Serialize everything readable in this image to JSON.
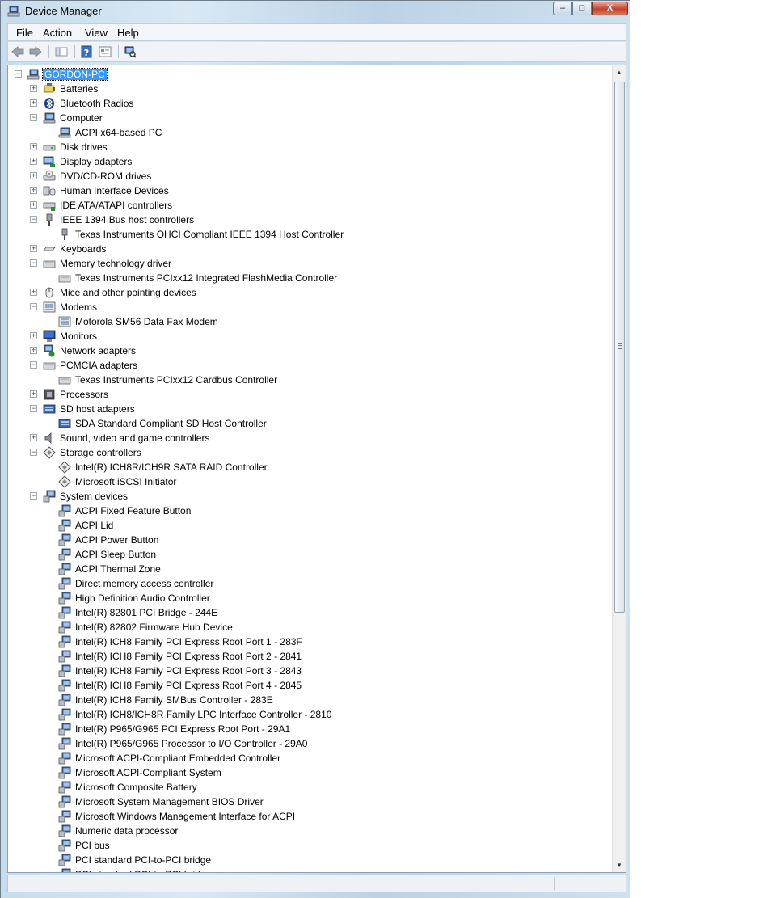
{
  "window": {
    "title": "Device Manager",
    "minimize_glyph": "–",
    "maximize_glyph": "□",
    "close_glyph": "X"
  },
  "menu": [
    "File",
    "Action",
    "View",
    "Help"
  ],
  "toolbar": {
    "icons": [
      "back-arrow-icon",
      "forward-arrow-icon",
      "show-hide-console-tree-icon",
      "help-icon",
      "properties-icon",
      "scan-hardware-icon"
    ]
  },
  "tree": {
    "root": "GORDON-PC",
    "nodes": [
      {
        "label": "Batteries",
        "level": 1,
        "state": "collapsed",
        "icon": "battery-icon"
      },
      {
        "label": "Bluetooth Radios",
        "level": 1,
        "state": "collapsed",
        "icon": "bluetooth-icon"
      },
      {
        "label": "Computer",
        "level": 1,
        "state": "expanded",
        "icon": "computer-icon"
      },
      {
        "label": "ACPI x64-based PC",
        "level": 2,
        "icon": "computer-icon"
      },
      {
        "label": "Disk drives",
        "level": 1,
        "state": "collapsed",
        "icon": "disk-drive-icon"
      },
      {
        "label": "Display adapters",
        "level": 1,
        "state": "collapsed",
        "icon": "display-adapter-icon"
      },
      {
        "label": "DVD/CD-ROM drives",
        "level": 1,
        "state": "collapsed",
        "icon": "dvd-drive-icon"
      },
      {
        "label": "Human Interface Devices",
        "level": 1,
        "state": "collapsed",
        "icon": "hid-icon"
      },
      {
        "label": "IDE ATA/ATAPI controllers",
        "level": 1,
        "state": "collapsed",
        "icon": "ide-controller-icon"
      },
      {
        "label": "IEEE 1394 Bus host controllers",
        "level": 1,
        "state": "expanded",
        "icon": "firewire-icon"
      },
      {
        "label": "Texas Instruments OHCI Compliant IEEE 1394 Host Controller",
        "level": 2,
        "icon": "firewire-icon"
      },
      {
        "label": "Keyboards",
        "level": 1,
        "state": "collapsed",
        "icon": "keyboard-icon"
      },
      {
        "label": "Memory technology driver",
        "level": 1,
        "state": "expanded",
        "icon": "card-icon"
      },
      {
        "label": "Texas Instruments PCIxx12 Integrated FlashMedia Controller",
        "level": 2,
        "icon": "card-icon"
      },
      {
        "label": "Mice and other pointing devices",
        "level": 1,
        "state": "collapsed",
        "icon": "mouse-icon"
      },
      {
        "label": "Modems",
        "level": 1,
        "state": "expanded",
        "icon": "modem-icon"
      },
      {
        "label": "Motorola SM56 Data Fax Modem",
        "level": 2,
        "icon": "modem-icon"
      },
      {
        "label": "Monitors",
        "level": 1,
        "state": "collapsed",
        "icon": "monitor-icon"
      },
      {
        "label": "Network adapters",
        "level": 1,
        "state": "collapsed",
        "icon": "network-adapter-icon"
      },
      {
        "label": "PCMCIA adapters",
        "level": 1,
        "state": "expanded",
        "icon": "card-icon"
      },
      {
        "label": "Texas Instruments PCIxx12 Cardbus Controller",
        "level": 2,
        "icon": "card-icon"
      },
      {
        "label": "Processors",
        "level": 1,
        "state": "collapsed",
        "icon": "processor-icon"
      },
      {
        "label": "SD host adapters",
        "level": 1,
        "state": "expanded",
        "icon": "sd-card-icon"
      },
      {
        "label": "SDA Standard Compliant SD Host Controller",
        "level": 2,
        "icon": "sd-card-icon"
      },
      {
        "label": "Sound, video and game controllers",
        "level": 1,
        "state": "collapsed",
        "icon": "speaker-icon"
      },
      {
        "label": "Storage controllers",
        "level": 1,
        "state": "expanded",
        "icon": "storage-controller-icon"
      },
      {
        "label": "Intel(R) ICH8R/ICH9R SATA RAID Controller",
        "level": 2,
        "icon": "storage-controller-icon"
      },
      {
        "label": "Microsoft iSCSI Initiator",
        "level": 2,
        "icon": "storage-controller-icon"
      },
      {
        "label": "System devices",
        "level": 1,
        "state": "expanded",
        "icon": "system-device-icon"
      },
      {
        "label": "ACPI Fixed Feature Button",
        "level": 2,
        "icon": "system-device-icon"
      },
      {
        "label": "ACPI Lid",
        "level": 2,
        "icon": "system-device-icon"
      },
      {
        "label": "ACPI Power Button",
        "level": 2,
        "icon": "system-device-icon"
      },
      {
        "label": "ACPI Sleep Button",
        "level": 2,
        "icon": "system-device-icon"
      },
      {
        "label": "ACPI Thermal Zone",
        "level": 2,
        "icon": "system-device-icon"
      },
      {
        "label": "Direct memory access controller",
        "level": 2,
        "icon": "system-device-icon"
      },
      {
        "label": "High Definition Audio Controller",
        "level": 2,
        "icon": "system-device-icon"
      },
      {
        "label": "Intel(R) 82801 PCI Bridge - 244E",
        "level": 2,
        "icon": "system-device-icon"
      },
      {
        "label": "Intel(R) 82802 Firmware Hub Device",
        "level": 2,
        "icon": "system-device-icon"
      },
      {
        "label": "Intel(R) ICH8 Family PCI Express Root Port 1 - 283F",
        "level": 2,
        "icon": "system-device-icon"
      },
      {
        "label": "Intel(R) ICH8 Family PCI Express Root Port 2 - 2841",
        "level": 2,
        "icon": "system-device-icon"
      },
      {
        "label": "Intel(R) ICH8 Family PCI Express Root Port 3 - 2843",
        "level": 2,
        "icon": "system-device-icon"
      },
      {
        "label": "Intel(R) ICH8 Family PCI Express Root Port 4 - 2845",
        "level": 2,
        "icon": "system-device-icon"
      },
      {
        "label": "Intel(R) ICH8 Family SMBus Controller - 283E",
        "level": 2,
        "icon": "system-device-icon"
      },
      {
        "label": "Intel(R) ICH8/ICH8R Family LPC Interface Controller - 2810",
        "level": 2,
        "icon": "system-device-icon"
      },
      {
        "label": "Intel(R) P965/G965 PCI Express Root Port - 29A1",
        "level": 2,
        "icon": "system-device-icon"
      },
      {
        "label": "Intel(R) P965/G965 Processor to I/O Controller - 29A0",
        "level": 2,
        "icon": "system-device-icon"
      },
      {
        "label": "Microsoft ACPI-Compliant Embedded Controller",
        "level": 2,
        "icon": "system-device-icon"
      },
      {
        "label": "Microsoft ACPI-Compliant System",
        "level": 2,
        "icon": "system-device-icon"
      },
      {
        "label": "Microsoft Composite Battery",
        "level": 2,
        "icon": "system-device-icon"
      },
      {
        "label": "Microsoft System Management BIOS Driver",
        "level": 2,
        "icon": "system-device-icon"
      },
      {
        "label": "Microsoft Windows Management Interface for ACPI",
        "level": 2,
        "icon": "system-device-icon"
      },
      {
        "label": "Numeric data processor",
        "level": 2,
        "icon": "system-device-icon"
      },
      {
        "label": "PCI bus",
        "level": 2,
        "icon": "system-device-icon"
      },
      {
        "label": "PCI standard PCI-to-PCI bridge",
        "level": 2,
        "icon": "system-device-icon"
      },
      {
        "label": "PCI standard PCI-to-PCI bridge",
        "level": 2,
        "icon": "system-device-icon"
      }
    ]
  },
  "colors": {
    "selection": "#3399ff",
    "frame": "#c7dcec",
    "close_button": "#c5412b"
  }
}
